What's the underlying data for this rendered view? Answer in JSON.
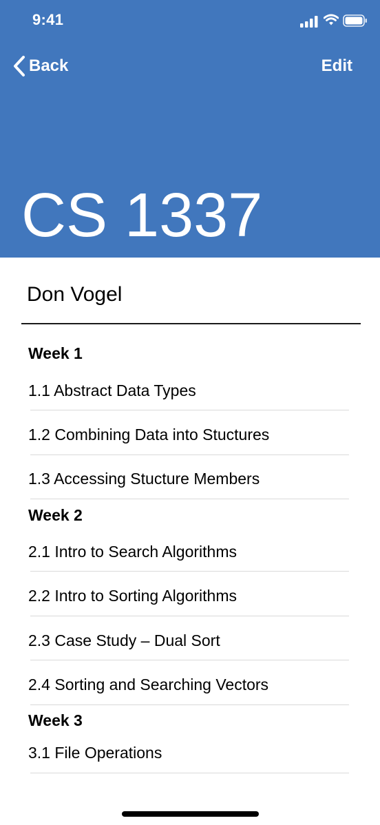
{
  "status_bar": {
    "time": "9:41"
  },
  "nav": {
    "back_label": "Back",
    "edit_label": "Edit"
  },
  "course": {
    "title": "CS 1337",
    "instructor": "Don Vogel"
  },
  "weeks": [
    {
      "heading": "Week 1",
      "lessons": [
        "1.1 Abstract Data Types",
        "1.2 Combining Data into Stuctures",
        "1.3 Accessing Stucture Members"
      ]
    },
    {
      "heading": "Week 2",
      "lessons": [
        "2.1 Intro to Search Algorithms",
        "2.2 Intro to Sorting Algorithms",
        "2.3 Case Study – Dual Sort",
        "2.4 Sorting and Searching Vectors"
      ]
    },
    {
      "heading": "Week 3",
      "lessons": [
        "3.1 File Operations"
      ]
    }
  ],
  "colors": {
    "header_bg": "#4177bd",
    "text": "#000000",
    "divider": "#d9d9d9"
  }
}
